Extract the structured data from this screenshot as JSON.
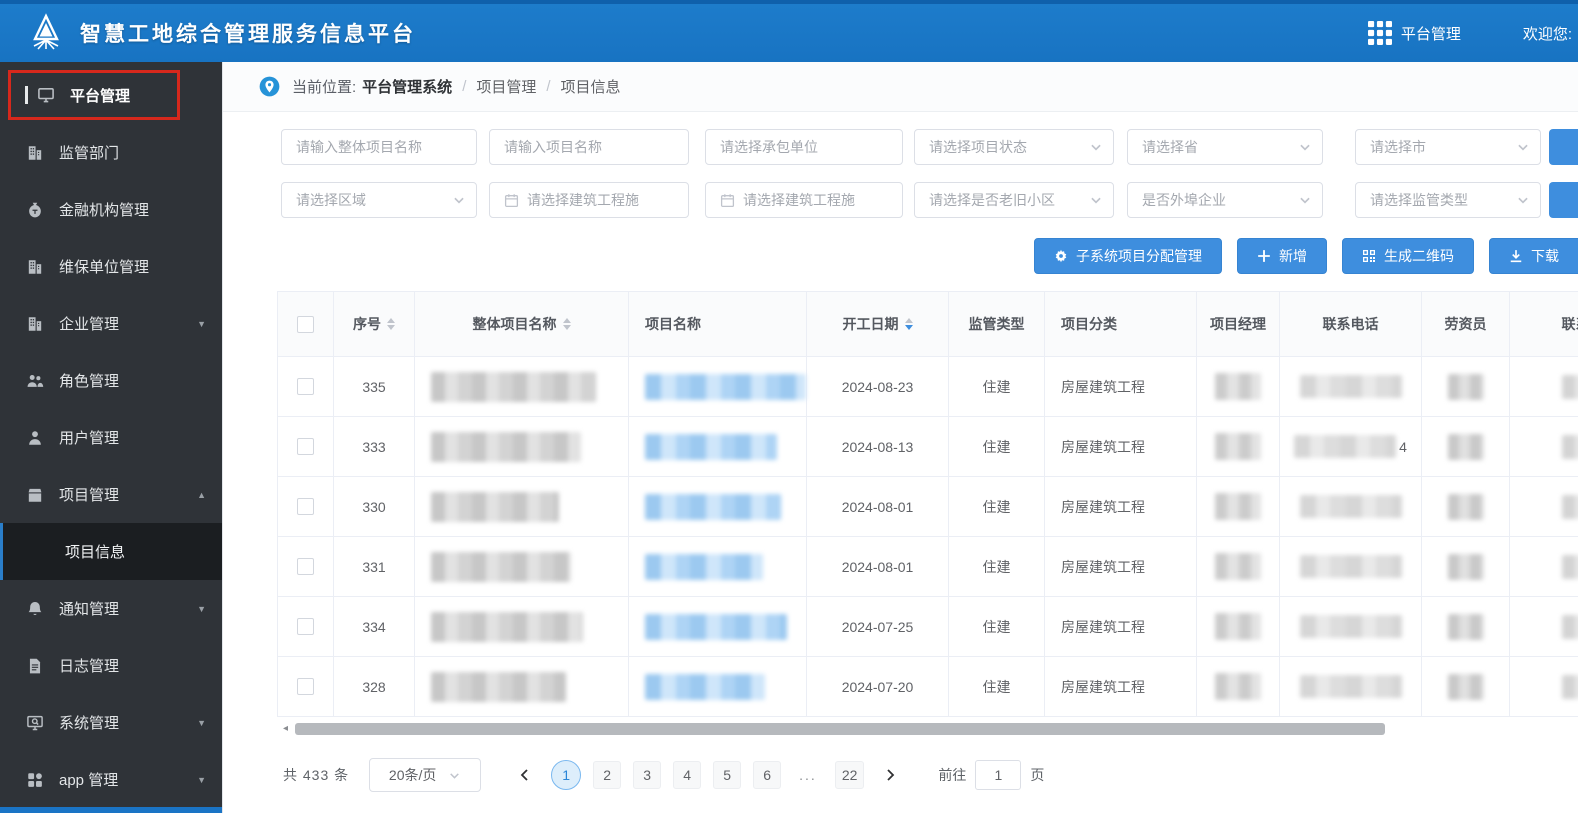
{
  "colors": {
    "header_blue": "#1a75c6",
    "accent_blue": "#3e8ede",
    "sidebar_bg": "#2f3338",
    "highlight_red": "#d6281c"
  },
  "header": {
    "title": "智慧工地综合管理服务信息平台",
    "nav_label": "平台管理",
    "welcome": "欢迎您:"
  },
  "sidebar": {
    "items": [
      {
        "id": "platform",
        "label": "平台管理",
        "icon": "monitor-icon",
        "highlighted": true
      },
      {
        "id": "regulator",
        "label": "监管部门",
        "icon": "building-icon"
      },
      {
        "id": "finance",
        "label": "金融机构管理",
        "icon": "moneybag-icon"
      },
      {
        "id": "maintenance",
        "label": "维保单位管理",
        "icon": "building-icon"
      },
      {
        "id": "enterprise",
        "label": "企业管理",
        "icon": "building-icon",
        "arrow": "down"
      },
      {
        "id": "role",
        "label": "角色管理",
        "icon": "group-icon"
      },
      {
        "id": "user",
        "label": "用户管理",
        "icon": "user-icon"
      },
      {
        "id": "project",
        "label": "项目管理",
        "icon": "folder-icon",
        "arrow": "up",
        "children": [
          {
            "id": "project-info",
            "label": "项目信息",
            "active": true
          }
        ]
      },
      {
        "id": "notice",
        "label": "通知管理",
        "icon": "bell-icon",
        "arrow": "down"
      },
      {
        "id": "log",
        "label": "日志管理",
        "icon": "log-icon"
      },
      {
        "id": "system",
        "label": "系统管理",
        "icon": "system-icon",
        "arrow": "down"
      },
      {
        "id": "app",
        "label": "app 管理",
        "icon": "app-icon",
        "arrow": "down"
      }
    ]
  },
  "breadcrumb": {
    "prefix": "当前位置:",
    "root": "平台管理系统",
    "separator": "/",
    "level2": "项目管理",
    "level3": "项目信息"
  },
  "filters": {
    "row1": [
      {
        "type": "text",
        "placeholder": "请输入整体项目名称"
      },
      {
        "type": "text",
        "placeholder": "请输入项目名称"
      },
      {
        "type": "select",
        "placeholder": "请选择承包单位",
        "chevron": false
      },
      {
        "type": "select",
        "placeholder": "请选择项目状态",
        "chevron": true
      },
      {
        "type": "select",
        "placeholder": "请选择省",
        "chevron": true
      },
      {
        "type": "select",
        "placeholder": "请选择市",
        "chevron": true
      },
      {
        "type": "button_clipped"
      }
    ],
    "row2": [
      {
        "type": "select",
        "placeholder": "请选择区域",
        "chevron": true
      },
      {
        "type": "date",
        "placeholder": "请选择建筑工程施"
      },
      {
        "type": "date",
        "placeholder": "请选择建筑工程施"
      },
      {
        "type": "select",
        "placeholder": "请选择是否老旧小区",
        "chevron": true
      },
      {
        "type": "select",
        "placeholder": "是否外埠企业",
        "chevron": true
      },
      {
        "type": "select",
        "placeholder": "请选择监管类型",
        "chevron": true
      },
      {
        "type": "button_clipped"
      }
    ]
  },
  "toolbar": [
    {
      "id": "subsystem-assign",
      "label": "子系统项目分配管理",
      "icon": "gear-icon"
    },
    {
      "id": "add",
      "label": "新增",
      "icon": "plus-icon"
    },
    {
      "id": "qrcode",
      "label": "生成二维码",
      "icon": "qrcode-icon"
    },
    {
      "id": "download",
      "label": "下载",
      "icon": "download-icon",
      "clipped": true
    }
  ],
  "table": {
    "columns": [
      {
        "id": "select",
        "type": "checkbox",
        "label": ""
      },
      {
        "id": "seq",
        "label": "序号",
        "sortable": true
      },
      {
        "id": "overall-name",
        "label": "整体项目名称",
        "sortable": true
      },
      {
        "id": "name",
        "label": "项目名称"
      },
      {
        "id": "start-date",
        "label": "开工日期",
        "sortable": true,
        "sorted": "desc"
      },
      {
        "id": "supervision",
        "label": "监管类型"
      },
      {
        "id": "category",
        "label": "项目分类"
      },
      {
        "id": "manager",
        "label": "项目经理"
      },
      {
        "id": "phone",
        "label": "联系电话"
      },
      {
        "id": "labor",
        "label": "劳资员"
      },
      {
        "id": "phone2",
        "label": "联系电话"
      }
    ],
    "rows": [
      {
        "seq": "335",
        "start_date": "2024-08-23",
        "supervision": "住建",
        "category": "房屋建筑工程",
        "phone_visible": ""
      },
      {
        "seq": "333",
        "start_date": "2024-08-13",
        "supervision": "住建",
        "category": "房屋建筑工程",
        "phone_visible": "4"
      },
      {
        "seq": "330",
        "start_date": "2024-08-01",
        "supervision": "住建",
        "category": "房屋建筑工程",
        "phone_visible": ""
      },
      {
        "seq": "331",
        "start_date": "2024-08-01",
        "supervision": "住建",
        "category": "房屋建筑工程",
        "phone_visible": ""
      },
      {
        "seq": "334",
        "start_date": "2024-07-25",
        "supervision": "住建",
        "category": "房屋建筑工程",
        "phone_visible": ""
      },
      {
        "seq": "328",
        "start_date": "2024-07-20",
        "supervision": "住建",
        "category": "房屋建筑工程",
        "phone_visible": ""
      }
    ]
  },
  "pagination": {
    "total": "共 433 条",
    "page_size": "20条/页",
    "pages": [
      "1",
      "2",
      "3",
      "4",
      "5",
      "6",
      "...",
      "22"
    ],
    "active_page": "1",
    "goto_label": "前往",
    "goto_value": "1",
    "goto_suffix": "页"
  }
}
